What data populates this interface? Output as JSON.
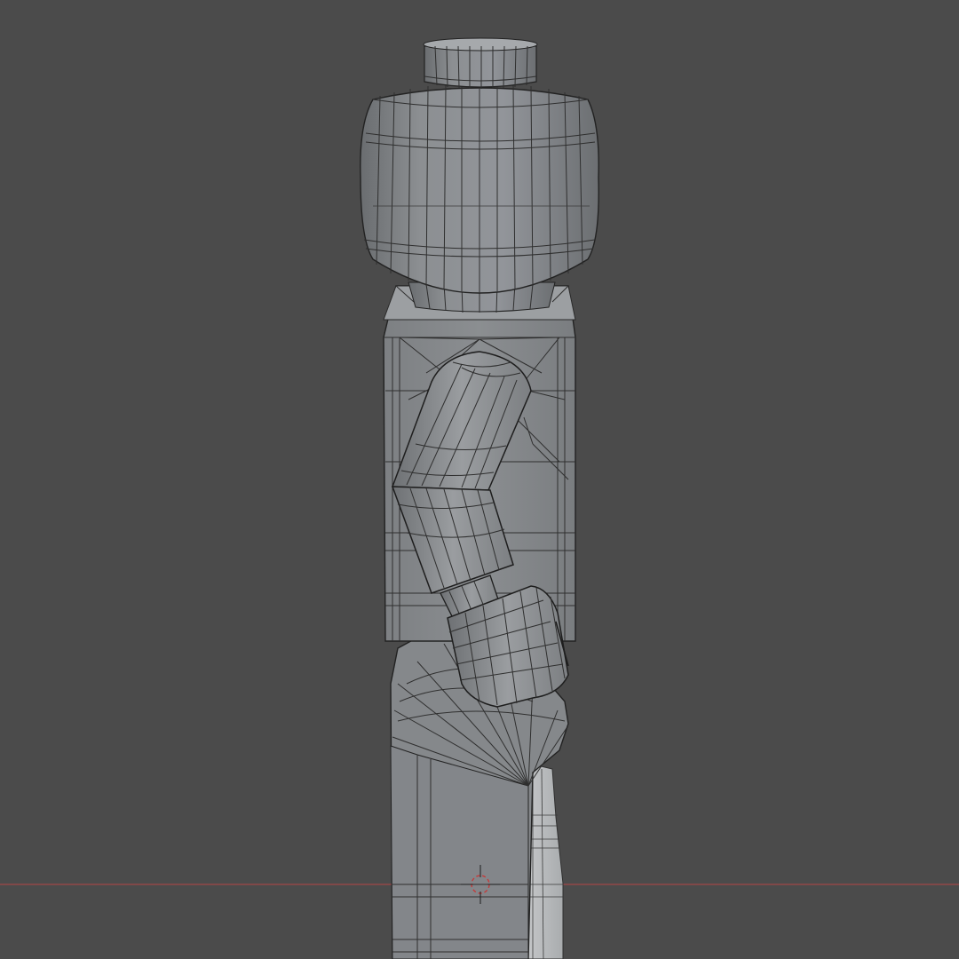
{
  "viewport": {
    "background_color": "#4b4b4b",
    "object_color": "#8a8d8f",
    "wire_color": "#2f2f2f",
    "x_axis_color": "#b54545",
    "cursor_color": "#c43a3a",
    "cursor_icon": "3d-cursor-icon",
    "object": "minifigure-mesh"
  }
}
